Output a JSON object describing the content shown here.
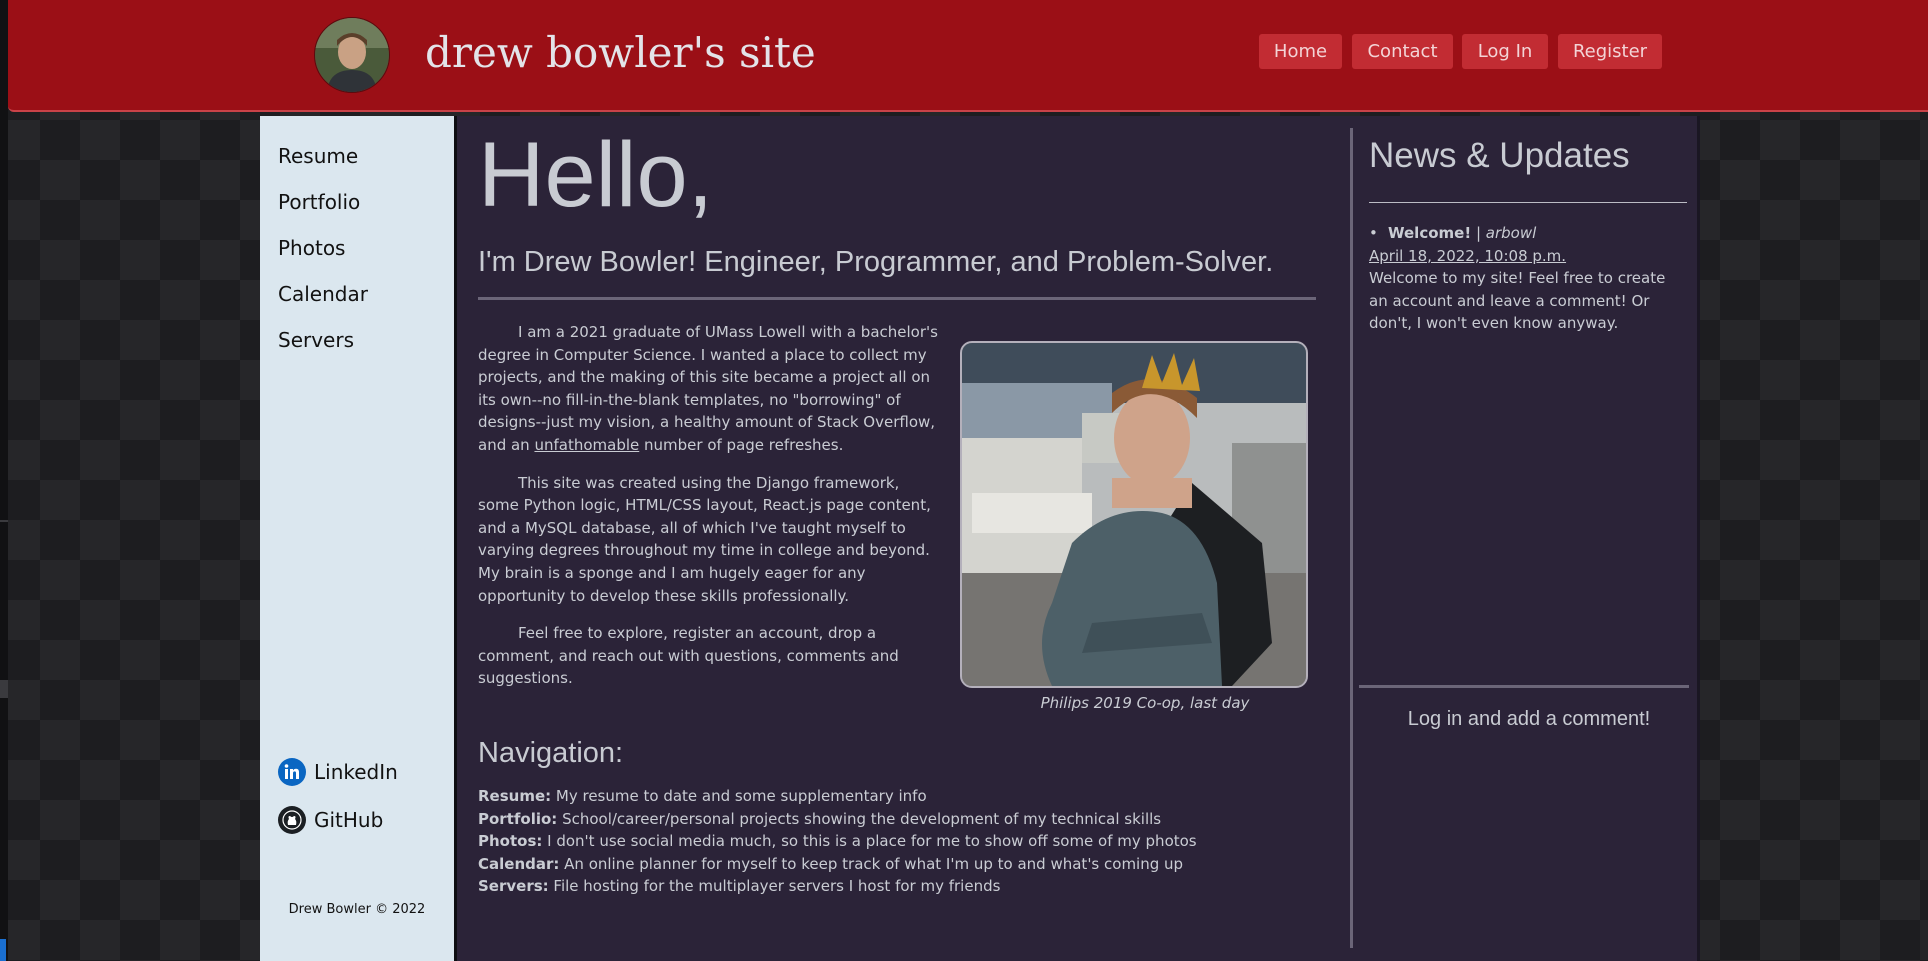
{
  "header": {
    "site_title": "drew bowler's site",
    "nav": [
      {
        "label": "Home"
      },
      {
        "label": "Contact"
      },
      {
        "label": "Log In"
      },
      {
        "label": "Register"
      }
    ]
  },
  "sidebar": {
    "links": [
      {
        "label": "Resume"
      },
      {
        "label": "Portfolio"
      },
      {
        "label": "Photos"
      },
      {
        "label": "Calendar"
      },
      {
        "label": "Servers"
      }
    ],
    "social": [
      {
        "label": "LinkedIn",
        "icon": "linkedin-icon"
      },
      {
        "label": "GitHub",
        "icon": "github-icon"
      }
    ],
    "copyright": "Drew Bowler © 2022"
  },
  "main": {
    "hello": "Hello,",
    "tagline": "I'm Drew Bowler! Engineer, Programmer, and Problem-Solver.",
    "bio": {
      "p1_before": "I am a 2021 graduate of UMass Lowell with a bachelor's degree in Computer Science. I wanted a place to collect my projects, and the making of this site became a project all on its own--no fill-in-the-blank templates, no \"borrowing\" of designs--just my vision, a healthy amount of Stack Overflow, and an ",
      "p1_link": "unfathomable",
      "p1_after": " number of page refreshes.",
      "p2": "This site was created using the Django framework, some Python logic, HTML/CSS layout, React.js page content, and a MySQL database, all of which I've taught myself to varying degrees throughout my time in college and beyond. My brain is a sponge and I am hugely eager for any opportunity to develop these skills professionally.",
      "p3": "Feel free to explore, register an account, drop a comment, and reach out with questions, comments and suggestions."
    },
    "photo_caption": "Philips 2019 Co-op, last day",
    "navigation": {
      "heading": "Navigation:",
      "items": [
        {
          "term": "Resume:",
          "desc": " My resume to date and some supplementary info"
        },
        {
          "term": "Portfolio:",
          "desc": " School/career/personal projects showing the development of my technical skills"
        },
        {
          "term": "Photos:",
          "desc": " I don't use social media much, so this is a place for me to show off some of my photos"
        },
        {
          "term": "Calendar:",
          "desc": " An online planner for myself to keep track of what I'm up to and what's coming up"
        },
        {
          "term": "Servers:",
          "desc": " File hosting for the multiplayer servers I host for my friends"
        }
      ]
    }
  },
  "news": {
    "title": "News & Updates",
    "item": {
      "headline": "Welcome!",
      "separator": " | ",
      "author": "arbowl",
      "date": "April 18, 2022, 10:08 p.m.",
      "body": "Welcome to my site! Feel free to create an account and leave a comment! Or don't, I won't even know anyway."
    },
    "comment_prompt": "Log in and add a comment!"
  },
  "colors": {
    "header": "#9b0f16",
    "nav_button": "#c22c33",
    "sidebar": "#dbe7ef",
    "content_bg": "#2b2338",
    "text": "#c9ccd3"
  }
}
